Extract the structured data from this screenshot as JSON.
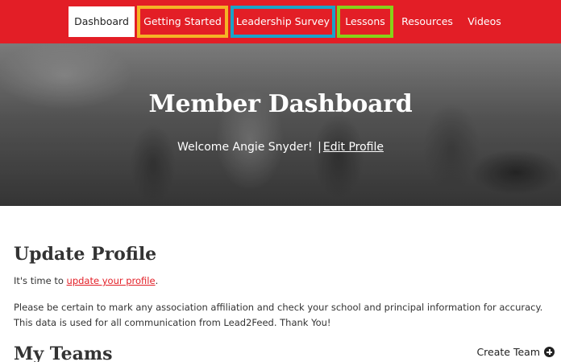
{
  "nav": {
    "items": [
      {
        "label": "Dashboard",
        "active": true
      },
      {
        "label": "Getting Started",
        "highlight": "#f5b325"
      },
      {
        "label": "Leadership Survey",
        "highlight": "#1aa3c8"
      },
      {
        "label": "Lessons",
        "highlight": "#86d219"
      },
      {
        "label": "Resources"
      },
      {
        "label": "Videos"
      }
    ],
    "background": "#e31e26"
  },
  "hero": {
    "title": "Member Dashboard",
    "welcome": "Welcome Angie Snyder!",
    "separator": "|",
    "edit_profile": "Edit Profile",
    "image": "group-photo-students"
  },
  "update_profile": {
    "heading": "Update Profile",
    "line1_prefix": "It's time to ",
    "line1_link": "update your profile",
    "line1_suffix": ".",
    "paragraph": "Please be certain to mark any association affiliation and check your school and principal information for accuracy. This data is used for all communication from Lead2Feed. Thank You!"
  },
  "teams": {
    "heading": "My Teams",
    "create_label": "Create Team",
    "create_icon": "plus-circle-icon"
  }
}
